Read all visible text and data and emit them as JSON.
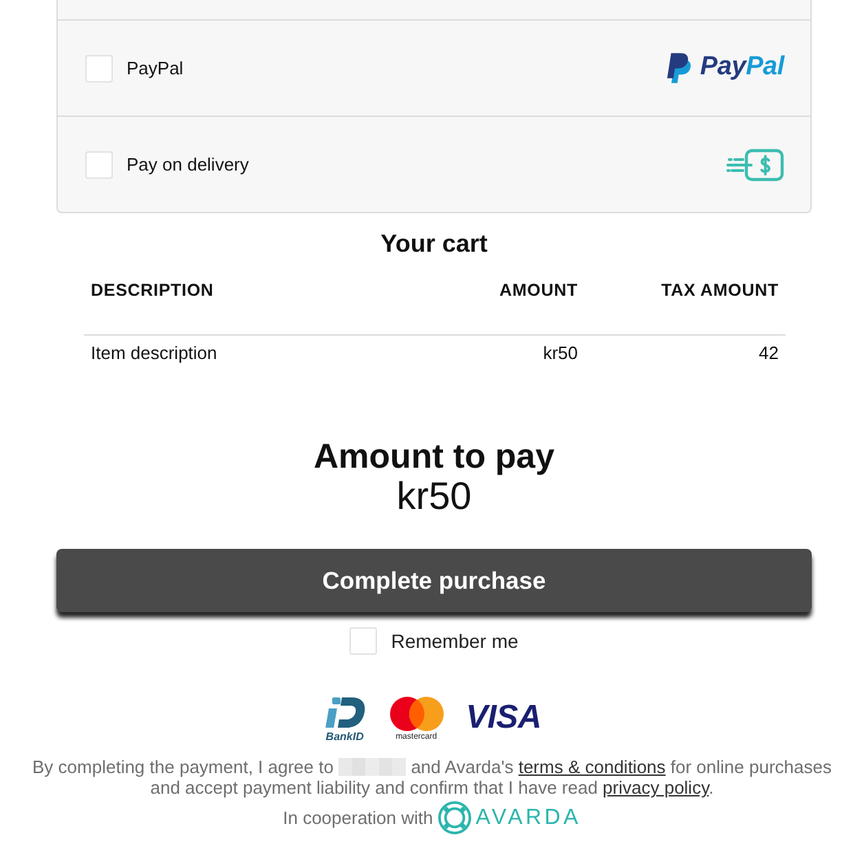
{
  "payment_options": [
    {
      "kind": "paypal",
      "label": "PayPal",
      "checked": false,
      "wordmark": [
        "Pay",
        "Pal"
      ]
    },
    {
      "kind": "delivery",
      "label": "Pay on delivery",
      "checked": false
    }
  ],
  "cart": {
    "title": "Your cart",
    "columns": [
      "DESCRIPTION",
      "AMOUNT",
      "TAX AMOUNT"
    ],
    "rows": [
      [
        "Item description",
        "kr50",
        "42"
      ]
    ]
  },
  "total": {
    "label": "Amount to pay",
    "value": "kr50"
  },
  "submit": {
    "label": "Complete purchase"
  },
  "remember": {
    "label": "Remember me",
    "checked": false
  },
  "payment_logos": [
    {
      "kind": "bankid",
      "caption": "BankID"
    },
    {
      "kind": "mastercard",
      "caption": "mastercard"
    },
    {
      "kind": "visa",
      "text": "VISA"
    }
  ],
  "consent": [
    {
      "kind": "text",
      "text": "By completing the payment, I agree to "
    },
    {
      "kind": "redacted"
    },
    {
      "kind": "text",
      "text": " and Avarda's "
    },
    {
      "kind": "link",
      "text": "terms & conditions"
    },
    {
      "kind": "text",
      "text": " for online purchases and accept payment liability and confirm that I have read "
    },
    {
      "kind": "link",
      "text": "privacy policy"
    },
    {
      "kind": "text",
      "text": "."
    }
  ],
  "cooperation": {
    "label": "In cooperation with",
    "partner": "AVARDA"
  }
}
